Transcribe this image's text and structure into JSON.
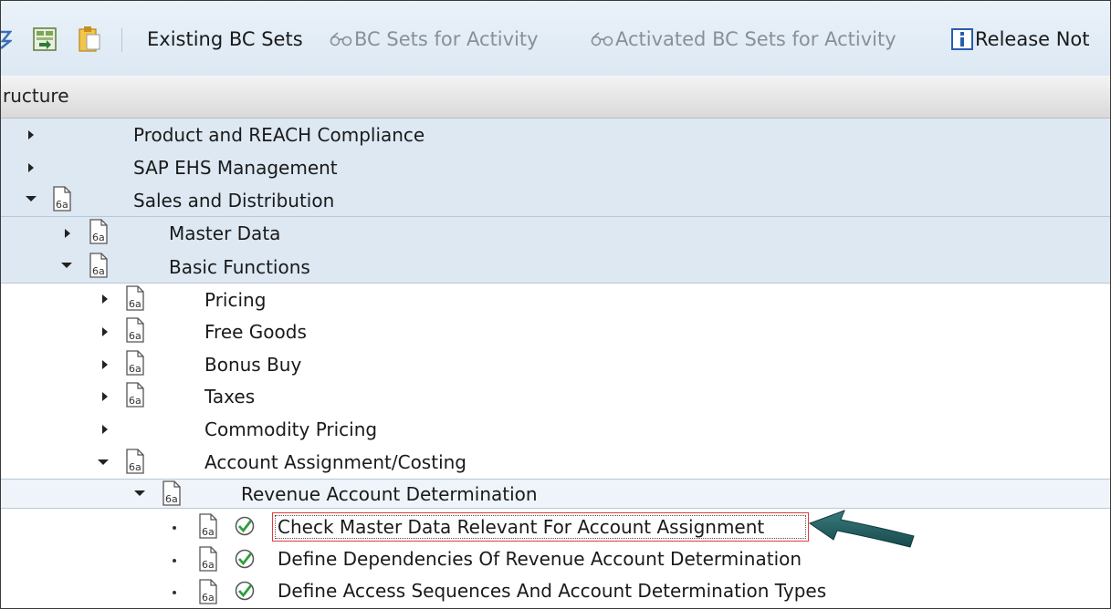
{
  "toolbar": {
    "existing_bc_sets": "Existing BC Sets",
    "bc_sets_for_activity": "BC Sets for Activity",
    "activated_bc_sets": "Activated BC Sets for Activity",
    "release_notes": "Release Not"
  },
  "header": {
    "label": "ructure"
  },
  "tree": {
    "product_reach": "Product and REACH Compliance",
    "sap_ehs": "SAP EHS Management",
    "sales_distribution": "Sales and Distribution",
    "master_data": "Master Data",
    "basic_functions": "Basic Functions",
    "pricing": "Pricing",
    "free_goods": "Free Goods",
    "bonus_buy": "Bonus Buy",
    "taxes": "Taxes",
    "commodity_pricing": "Commodity Pricing",
    "account_assignment": "Account Assignment/Costing",
    "revenue_account_determination": "Revenue Account Determination",
    "check_master_data": "Check Master Data Relevant For Account Assignment",
    "define_dependencies": "Define Dependencies Of Revenue Account Determination",
    "define_access_sequences": "Define Access Sequences And Account Determination Types"
  },
  "icons": {
    "bc_set": "bc-set-doc-icon",
    "execute": "clock-check-icon",
    "arrow": "callout-arrow-icon",
    "info": "info-icon"
  },
  "colors": {
    "toolbar_bg": "#e3edf6",
    "tree_blue": "#dde8f3",
    "focus_red": "#e53a3a",
    "arrow_teal": "#1f5a5c"
  }
}
